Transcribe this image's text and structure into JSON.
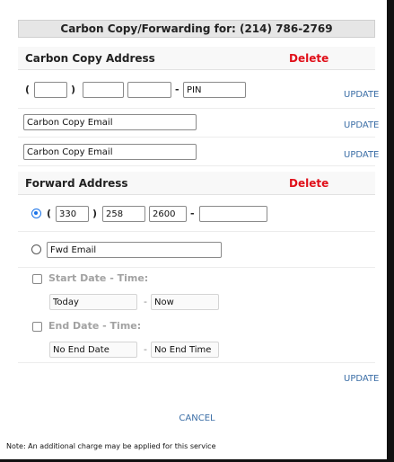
{
  "title": "Carbon Copy/Forwarding for: (214) 786-2769",
  "carbon_copy": {
    "header": "Carbon Copy Address",
    "delete_label": "Delete",
    "phone": {
      "open_paren": "(",
      "close_paren": ")",
      "dash": "-",
      "area": "",
      "prefix": "",
      "line": "",
      "pin_placeholder": "PIN"
    },
    "emails": [
      {
        "placeholder": "Carbon Copy Email"
      },
      {
        "placeholder": "Carbon Copy Email"
      }
    ],
    "update_label": "UPDATE"
  },
  "forward": {
    "header": "Forward Address",
    "delete_label": "Delete",
    "phone": {
      "open_paren": "(",
      "close_paren": ")",
      "dash": "-",
      "area": "330",
      "prefix": "258",
      "line": "2600",
      "ext": "",
      "selected": true
    },
    "email": {
      "placeholder": "Fwd Email",
      "selected": false
    },
    "start": {
      "label": "Start Date - Time:",
      "date_placeholder": "Today",
      "dash": "-",
      "time_placeholder": "Now",
      "checked": false
    },
    "end": {
      "label": "End Date - Time:",
      "date_placeholder": "No End Date",
      "dash": "-",
      "time_placeholder": "No End Time",
      "checked": false
    },
    "update_label": "UPDATE"
  },
  "cancel_label": "CANCEL",
  "note": "Note: An additional charge may be applied for this service",
  "colors": {
    "delete": "#e0101a",
    "link": "#3b6ea6",
    "radio_selected": "#1a73e8"
  }
}
